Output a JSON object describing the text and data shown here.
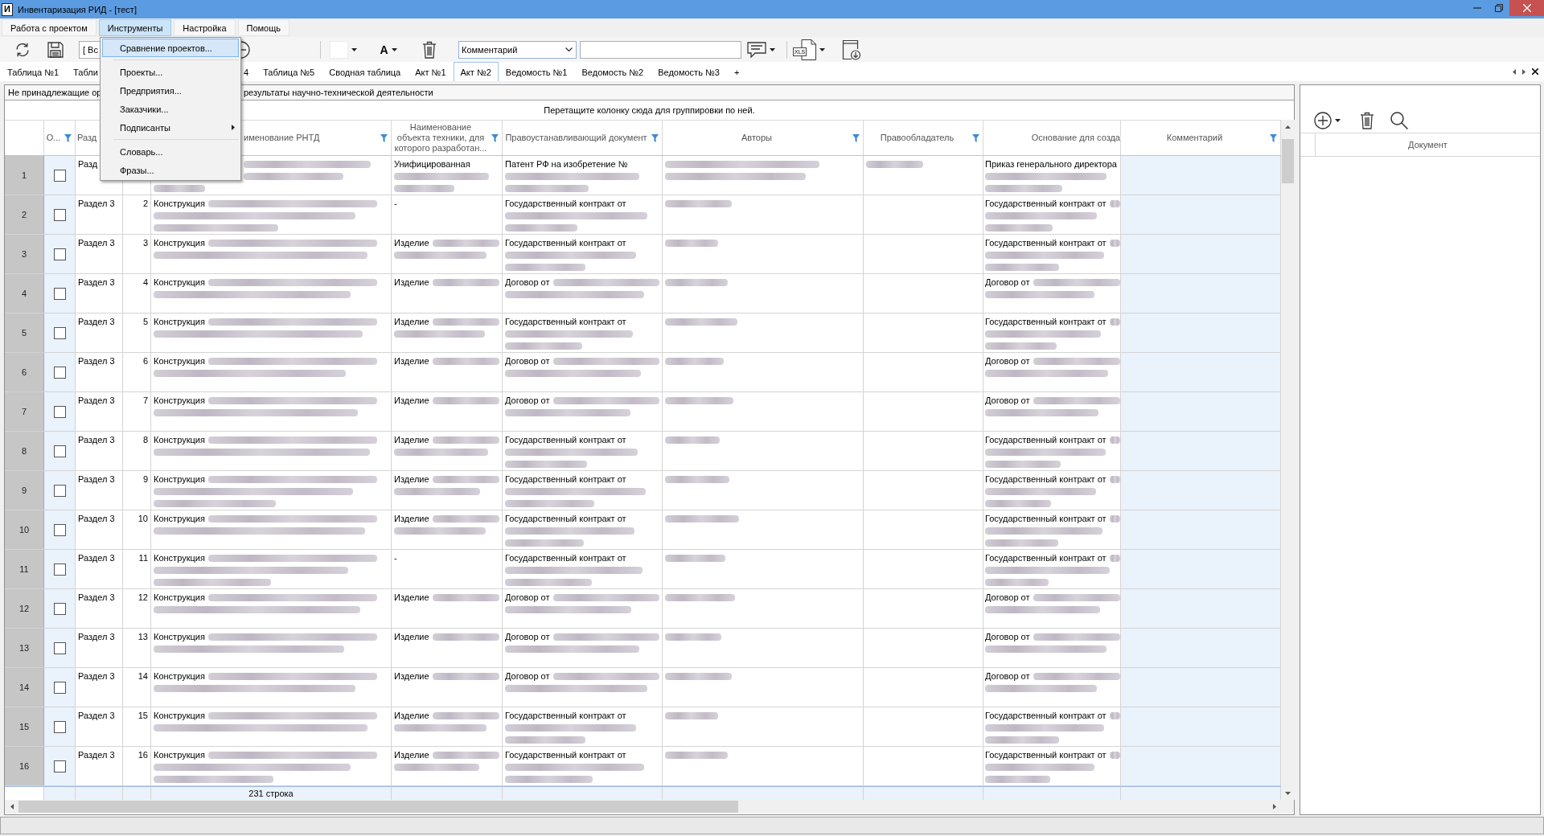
{
  "window": {
    "icon_letter": "И",
    "title": "Инвентаризация РИД - [тест]"
  },
  "menu_bar": [
    {
      "label": "Работа с проектом",
      "selected": false
    },
    {
      "label": "Инструменты",
      "selected": true
    },
    {
      "label": "Настройка",
      "selected": false
    },
    {
      "label": "Помощь",
      "selected": false
    }
  ],
  "toolbar": {
    "filter_combo": {
      "value": "[ Вс"
    },
    "font_button": {
      "letter": "A"
    },
    "field_combo": {
      "value": "Комментарий"
    },
    "export_button": {
      "label": "XLS"
    }
  },
  "tabs": [
    {
      "label": "Таблица №1",
      "selected": false
    },
    {
      "label": "Табли",
      "selected": false,
      "cut_end": true
    },
    {
      "label": "4",
      "selected": false,
      "cut_start": true
    },
    {
      "label": "Таблица №5",
      "selected": false
    },
    {
      "label": "Сводная таблица",
      "selected": false
    },
    {
      "label": "Акт №1",
      "selected": false
    },
    {
      "label": "Акт №2",
      "selected": true
    },
    {
      "label": "Ведомость №1",
      "selected": false
    },
    {
      "label": "Ведомость №2",
      "selected": false
    },
    {
      "label": "Ведомость №3",
      "selected": false
    },
    {
      "label": "+",
      "selected": false
    }
  ],
  "info_bar": {
    "texts": [
      "Не принадлежащие ор",
      "результаты научно-технической деятельности"
    ]
  },
  "group_panel": {
    "hint": "Перетащите колонку сюда для группировки по ней."
  },
  "table": {
    "columns": [
      {},
      {
        "label": "О...",
        "filter": true
      },
      {
        "label": "Разд",
        "filter": false
      },
      {},
      {
        "label": "именование РНТД",
        "filter": true
      },
      {
        "label": "Наименование\nобъекта техники, для\nкоторого разработан...",
        "filter": true
      },
      {
        "label": "Правоустанавливающий документ",
        "filter": true
      },
      {
        "label": "Авторы",
        "filter": true
      },
      {
        "label": "Правообладатель",
        "filter": true
      },
      {
        "label": "Основание для созда",
        "filter": false
      },
      {
        "label": "Комментарий",
        "filter": true
      }
    ],
    "rows": [
      {
        "row_label": "1",
        "checked": false,
        "section": "Разд",
        "name": {
          "blur_line1": true,
          "blur_line2": true,
          "blur_line3": true,
          "covered": true
        },
        "object": {
          "text": "Унифицированная",
          "blur_line2": true,
          "blur_line3": true
        },
        "document": {
          "text": "Патент РФ на изобретение №",
          "blur_line2": true,
          "blur_line3": true
        },
        "authors": {
          "blur_line1": true,
          "blur_line2": true
        },
        "owner": {
          "blur_line1": true
        },
        "basis": {
          "text": "Приказ генерального директора",
          "blur_line2": true,
          "blur_line3": true
        }
      },
      {
        "row_label": "2",
        "checked": false,
        "section": "Раздел 3",
        "number": "2",
        "name": {
          "text": "Конструкция",
          "blur_tail": true,
          "blur_line2": true,
          "blur_line3": true
        },
        "object": {
          "text": "-"
        },
        "document": {
          "text": "Государственный контракт от",
          "blur_line2": true,
          "blur_line3": true
        },
        "authors": {
          "blur_line1": true
        },
        "basis": {
          "text": "Государственный контракт от",
          "blur_tail": true,
          "blur_line2": true,
          "blur_line3": true
        }
      },
      {
        "row_label": "3",
        "checked": false,
        "section": "Раздел 3",
        "number": "3",
        "name": {
          "text": "Конструкция",
          "blur_tail": true,
          "blur_line2": true
        },
        "object": {
          "text": "Изделие",
          "blur_tail": true,
          "blur_line2": true
        },
        "document": {
          "text": "Государственный контракт от",
          "blur_line2": true,
          "blur_line3": true
        },
        "authors": {
          "blur_line1": true
        },
        "basis": {
          "text": "Государственный контракт от",
          "blur_tail": true,
          "blur_line2": true,
          "blur_line3": true
        }
      },
      {
        "row_label": "4",
        "checked": false,
        "section": "Раздел 3",
        "number": "4",
        "name": {
          "text": "Конструкция",
          "blur_tail": true,
          "blur_line2": true
        },
        "object": {
          "text": "Изделие",
          "blur_tail": true
        },
        "document": {
          "text": "Договор от",
          "blur_tail": true,
          "blur_line2": true
        },
        "authors": {
          "blur_line1": true
        },
        "basis": {
          "text": "Договор от",
          "blur_tail": true,
          "blur_line2": true
        }
      },
      {
        "row_label": "5",
        "checked": false,
        "section": "Раздел 3",
        "number": "5",
        "name": {
          "text": "Конструкция",
          "blur_tail": true,
          "blur_line2": true
        },
        "object": {
          "text": "Изделие",
          "blur_tail": true,
          "blur_line2": true
        },
        "document": {
          "text": "Государственный контракт от",
          "blur_line2": true,
          "blur_line3": true
        },
        "authors": {
          "blur_line1": true
        },
        "basis": {
          "text": "Государственный контракт от",
          "blur_tail": true,
          "blur_line2": true,
          "blur_line3": true
        }
      },
      {
        "row_label": "6",
        "checked": false,
        "section": "Раздел 3",
        "number": "6",
        "name": {
          "text": "Конструкция",
          "blur_tail": true,
          "blur_line2": true
        },
        "object": {
          "text": "Изделие",
          "blur_tail": true
        },
        "document": {
          "text": "Договор от",
          "blur_tail": true,
          "blur_line2": true
        },
        "authors": {
          "blur_line1": true
        },
        "basis": {
          "text": "Договор от",
          "blur_tail": true,
          "blur_line2": true
        }
      },
      {
        "row_label": "7",
        "checked": false,
        "section": "Раздел 3",
        "number": "7",
        "name": {
          "text": "Конструкция",
          "blur_tail": true,
          "blur_line2": true
        },
        "object": {
          "text": "Изделие",
          "blur_tail": true
        },
        "document": {
          "text": "Договор от",
          "blur_tail": true,
          "blur_line2": true
        },
        "authors": {
          "blur_line1": true
        },
        "basis": {
          "text": "Договор от",
          "blur_tail": true,
          "blur_line2": true
        }
      },
      {
        "row_label": "8",
        "checked": false,
        "section": "Раздел 3",
        "number": "8",
        "name": {
          "text": "Конструкция",
          "blur_tail": true,
          "blur_line2": true
        },
        "object": {
          "text": "Изделие",
          "blur_tail": true,
          "blur_line2": true
        },
        "document": {
          "text": "Государственный контракт от",
          "blur_line2": true,
          "blur_line3": true
        },
        "authors": {
          "blur_line1": true
        },
        "basis": {
          "text": "Государственный контракт от",
          "blur_tail": true,
          "blur_line2": true,
          "blur_line3": true
        }
      },
      {
        "row_label": "9",
        "checked": false,
        "section": "Раздел 3",
        "number": "9",
        "name": {
          "text": "Конструкция",
          "blur_tail": true,
          "blur_line2": true,
          "blur_line3": true
        },
        "object": {
          "text": "Изделие",
          "blur_tail": true,
          "blur_line2": true
        },
        "document": {
          "text": "Государственный контракт от",
          "blur_line2": true,
          "blur_line3": true
        },
        "authors": {
          "blur_line1": true
        },
        "basis": {
          "text": "Государственный контракт от",
          "blur_tail": true,
          "blur_line2": true,
          "blur_line3": true
        }
      },
      {
        "row_label": "10",
        "checked": false,
        "section": "Раздел 3",
        "number": "10",
        "name": {
          "text": "Конструкция",
          "blur_tail": true,
          "blur_line2": true
        },
        "object": {
          "text": "Изделие",
          "blur_tail": true,
          "blur_line2": true
        },
        "document": {
          "text": "Государственный контракт от",
          "blur_line2": true,
          "blur_line3": true
        },
        "authors": {
          "blur_line1": true
        },
        "basis": {
          "text": "Государственный контракт от",
          "blur_tail": true,
          "blur_line2": true,
          "blur_line3": true
        }
      },
      {
        "row_label": "11",
        "checked": false,
        "section": "Раздел 3",
        "number": "11",
        "name": {
          "text": "Конструкция",
          "blur_tail": true,
          "blur_line2": true,
          "blur_line3": true
        },
        "object": {
          "text": "-"
        },
        "document": {
          "text": "Государственный контракт от",
          "blur_line2": true,
          "blur_line3": true
        },
        "authors": {
          "blur_line1": true
        },
        "basis": {
          "text": "Государственный контракт от",
          "blur_tail": true,
          "blur_line2": true,
          "blur_line3": true
        }
      },
      {
        "row_label": "12",
        "checked": false,
        "section": "Раздел 3",
        "number": "12",
        "name": {
          "text": "Конструкция",
          "blur_tail": true,
          "blur_line2": true
        },
        "object": {
          "text": "Изделие",
          "blur_tail": true
        },
        "document": {
          "text": "Договор от",
          "blur_tail": true,
          "blur_line2": true
        },
        "authors": {
          "blur_line1": true
        },
        "basis": {
          "text": "Договор от",
          "blur_tail": true,
          "blur_line2": true
        }
      },
      {
        "row_label": "13",
        "checked": false,
        "section": "Раздел 3",
        "number": "13",
        "name": {
          "text": "Конструкция",
          "blur_tail": true,
          "blur_line2": true
        },
        "object": {
          "text": "Изделие",
          "blur_tail": true
        },
        "document": {
          "text": "Договор от",
          "blur_tail": true,
          "blur_line2": true
        },
        "authors": {
          "blur_line1": true
        },
        "basis": {
          "text": "Договор от",
          "blur_tail": true,
          "blur_line2": true
        }
      },
      {
        "row_label": "14",
        "checked": false,
        "section": "Раздел 3",
        "number": "14",
        "name": {
          "text": "Конструкция",
          "blur_tail": true,
          "blur_line2": true
        },
        "object": {
          "text": "Изделие",
          "blur_tail": true
        },
        "document": {
          "text": "Договор от",
          "blur_tail": true,
          "blur_line2": true
        },
        "authors": {
          "blur_line1": true
        },
        "basis": {
          "text": "Договор от",
          "blur_tail": true,
          "blur_line2": true
        }
      },
      {
        "row_label": "15",
        "checked": false,
        "section": "Раздел 3",
        "number": "15",
        "name": {
          "text": "Конструкция",
          "blur_tail": true,
          "blur_line2": true
        },
        "object": {
          "text": "Изделие",
          "blur_tail": true,
          "blur_line2": true
        },
        "document": {
          "text": "Государственный контракт от",
          "blur_line2": true,
          "blur_line3": true
        },
        "authors": {
          "blur_line1": true
        },
        "basis": {
          "text": "Государственный контракт от",
          "blur_tail": true,
          "blur_line2": true,
          "blur_line3": true
        }
      },
      {
        "row_label": "16",
        "checked": false,
        "section": "Раздел 3",
        "number": "16",
        "name": {
          "text": "Конструкция",
          "blur_tail": true,
          "blur_line2": true,
          "blur_line3": true
        },
        "object": {
          "text": "Изделие",
          "blur_tail": true,
          "blur_line2": true
        },
        "document": {
          "text": "Государственный контракт от",
          "blur_line2": true,
          "blur_line3": true
        },
        "authors": {
          "blur_line1": true
        },
        "basis": {
          "text": "Государственный контракт от",
          "blur_tail": true,
          "blur_line2": true,
          "blur_line3": true
        }
      }
    ],
    "footer": {
      "count": "231 строка"
    }
  },
  "side_panel": {
    "column": "Документ"
  },
  "dropdown_menu": {
    "items": [
      {
        "kind": "item",
        "label": "Сравнение проектов...",
        "selected": true
      },
      {
        "kind": "separator"
      },
      {
        "kind": "item",
        "label": "Проекты...",
        "selected": false
      },
      {
        "kind": "item",
        "label": "Предприятия...",
        "selected": false
      },
      {
        "kind": "item",
        "label": "Заказчики...",
        "selected": false
      },
      {
        "kind": "submenu",
        "label": "Подписанты",
        "selected": false
      },
      {
        "kind": "separator"
      },
      {
        "kind": "item",
        "label": "Словарь...",
        "selected": false
      },
      {
        "kind": "item",
        "label": "Фразы...",
        "selected": false
      }
    ]
  }
}
